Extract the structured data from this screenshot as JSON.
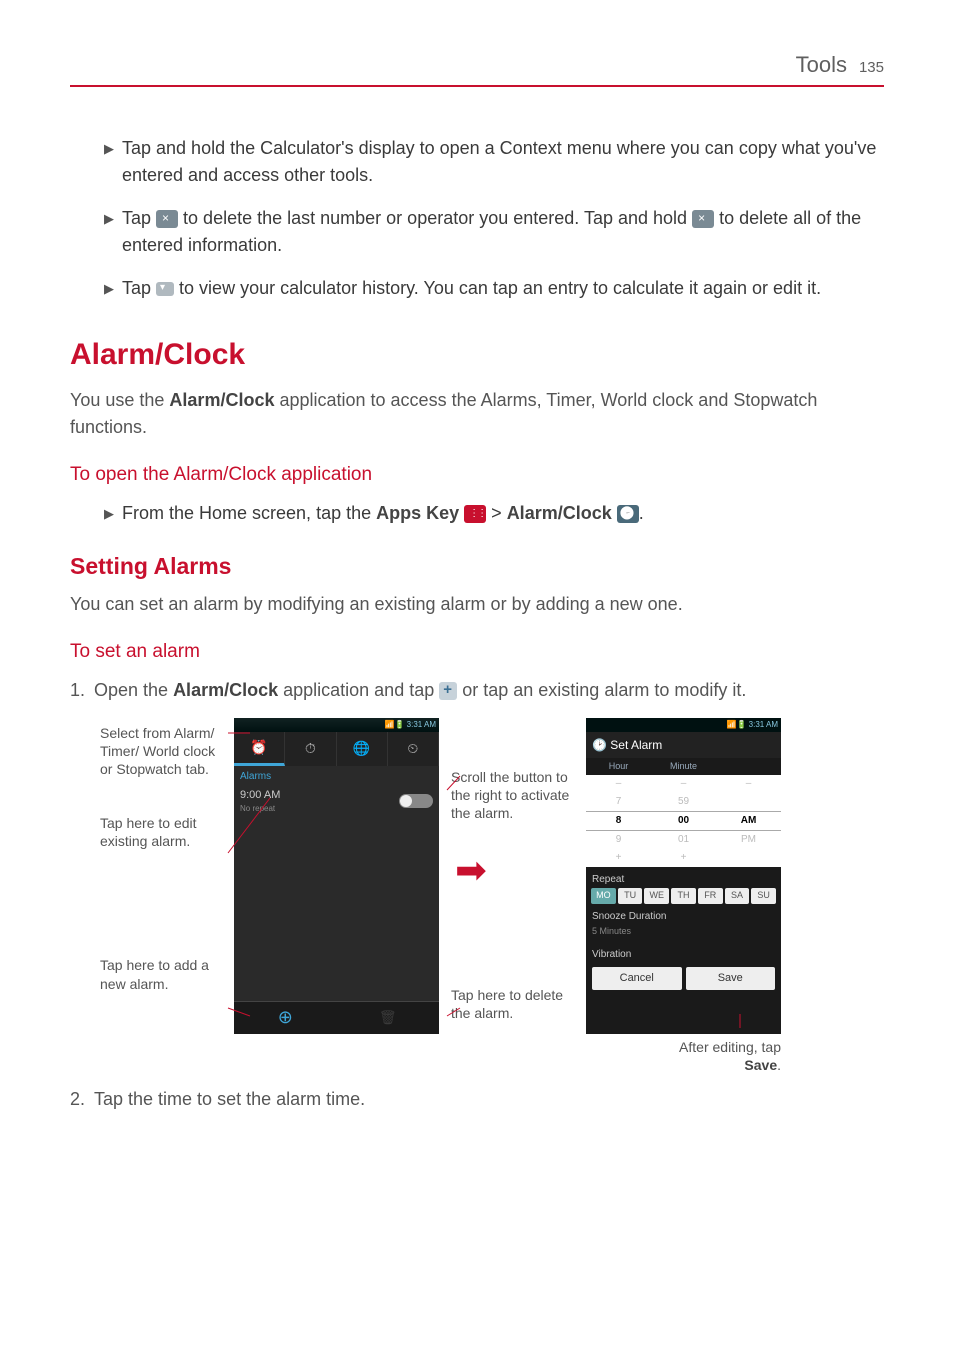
{
  "header": {
    "section": "Tools",
    "page": "135"
  },
  "bullets": [
    "Tap and hold the Calculator's display to open a Context menu where you can copy what you've entered and access other tools.",
    {
      "pre": "Tap ",
      "post_icon1": " to delete the last number or operator you entered. Tap and hold ",
      "post_icon2": " to delete all of the entered information."
    },
    {
      "pre": "Tap ",
      "post": " to view your calculator history. You can tap an entry to calculate it again or edit it."
    }
  ],
  "h1": "Alarm/Clock",
  "intro_pre": "You use the ",
  "intro_bold": "Alarm/Clock",
  "intro_post": " application to access the Alarms, Timer, World clock and Stopwatch functions.",
  "sub1": "To open the Alarm/Clock application",
  "open_line_pre": "From the Home screen, tap the ",
  "open_line_b1": "Apps Key",
  "open_line_mid": " > ",
  "open_line_b2": "Alarm/Clock",
  "open_line_post": ".",
  "h2": "Setting Alarms",
  "setting_p": "You can set an alarm by modifying an existing alarm or by adding a new one.",
  "sub2": "To set an alarm",
  "step1_num": "1.",
  "step1_pre": "Open the ",
  "step1_b": "Alarm/Clock",
  "step1_mid": " application and tap ",
  "step1_post": " or tap an existing alarm to modify it.",
  "labels": {
    "select_tab": "Select from Alarm/ Timer/ World clock or Stopwatch tab.",
    "edit_existing": "Tap here to edit existing alarm.",
    "add_new": "Tap here to add a new alarm.",
    "scroll": "Scroll the button to the right to activate the alarm.",
    "delete": "Tap here to delete the alarm.",
    "after_edit_pre": "After editing, tap ",
    "after_edit_b": "Save",
    "after_edit_post": "."
  },
  "phone1": {
    "time": "3:31 AM",
    "tabs_icons": [
      "alarm",
      "timer",
      "world",
      "stopwatch"
    ],
    "alarms_label": "Alarms",
    "alarm_time": "9:00 AM",
    "alarm_sub": "No repeat"
  },
  "phone2": {
    "time": "3:31 AM",
    "title": "Set Alarm",
    "wheel_headers": [
      "Hour",
      "Minute",
      ""
    ],
    "wheel": {
      "prev": [
        "7",
        "59",
        ""
      ],
      "sel": [
        "8",
        "00",
        "AM"
      ],
      "next": [
        "9",
        "01",
        "PM"
      ]
    },
    "repeat_label": "Repeat",
    "days": [
      "MO",
      "TU",
      "WE",
      "TH",
      "FR",
      "SA",
      "SU"
    ],
    "snooze_label": "Snooze Duration",
    "snooze_value": "5 Minutes",
    "vibration_label": "Vibration",
    "cancel": "Cancel",
    "save": "Save"
  },
  "step2_num": "2.",
  "step2_text": "Tap the time to set the alarm time."
}
